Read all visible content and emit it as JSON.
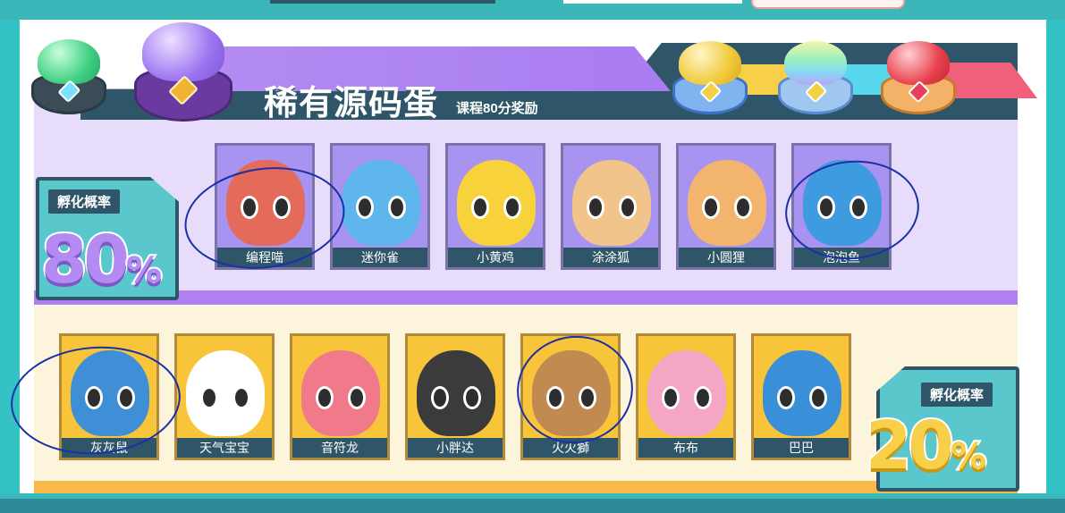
{
  "rare": {
    "title": "稀有源码蛋",
    "subtitle": "课程80分奖励",
    "rate_label": "孵化概率",
    "rate_value": "80",
    "rate_unit": "%",
    "pets": [
      {
        "name": "编程喵",
        "color": "#e46a5a"
      },
      {
        "name": "迷你雀",
        "color": "#5fb6ec"
      },
      {
        "name": "小黄鸡",
        "color": "#f7d23a"
      },
      {
        "name": "涂涂狐",
        "color": "#f0c48a"
      },
      {
        "name": "小圆狸",
        "color": "#f3b56e"
      },
      {
        "name": "泡泡鱼",
        "color": "#3e9be0"
      }
    ]
  },
  "common": {
    "rate_label": "孵化概率",
    "rate_value": "20",
    "rate_unit": "%",
    "pets": [
      {
        "name": "灰灰鼠",
        "color": "#3e8fd6"
      },
      {
        "name": "天气宝宝",
        "color": "#ffffff"
      },
      {
        "name": "音符龙",
        "color": "#f07a8a"
      },
      {
        "name": "小胖达",
        "color": "#3b3b3b"
      },
      {
        "name": "火火獅",
        "color": "#c08a50"
      },
      {
        "name": "布布",
        "color": "#f5a6c4"
      },
      {
        "name": "巴巴",
        "color": "#3a90d8"
      }
    ]
  }
}
